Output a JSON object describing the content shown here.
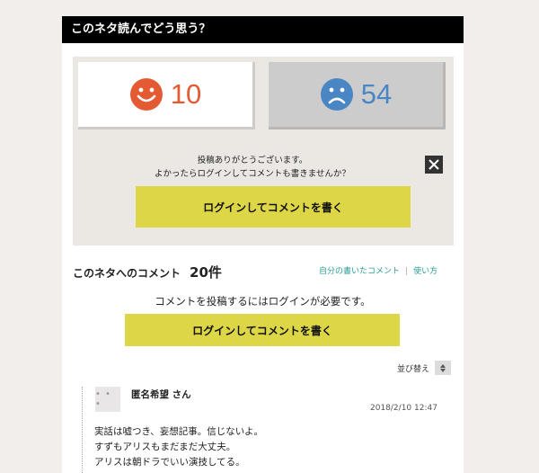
{
  "header": {
    "title": "このネタ読んでどう思う？"
  },
  "vote": {
    "good_count": "10",
    "bad_count": "54",
    "thanks_line1": "投稿ありがとうございます。",
    "thanks_line2": "よかったらログインしてコメントも書きませんか？",
    "login_button": "ログインしてコメントを書く",
    "colors": {
      "good": "#e45a33",
      "bad": "#4a86c4",
      "button": "#ddd646"
    }
  },
  "comments": {
    "title": "このネタへのコメント",
    "count": "20件",
    "link_my_comments": "自分の書いたコメント",
    "link_separator": "|",
    "link_howto": "使い方",
    "login_required": "コメントを投稿するにはログインが必要です。",
    "login_button": "ログインしてコメントを書く",
    "sort_label": "並び替え",
    "items": [
      {
        "avatar": "• • •",
        "name": "匿名希望 さん",
        "date": "2018/2/10 12:47",
        "body": "実話は嘘つき、妄想記事。信じないよ。\nすずもアリスもまだまだ大丈夫。\nアリスは朝ドラでいい演技してる。"
      }
    ]
  }
}
